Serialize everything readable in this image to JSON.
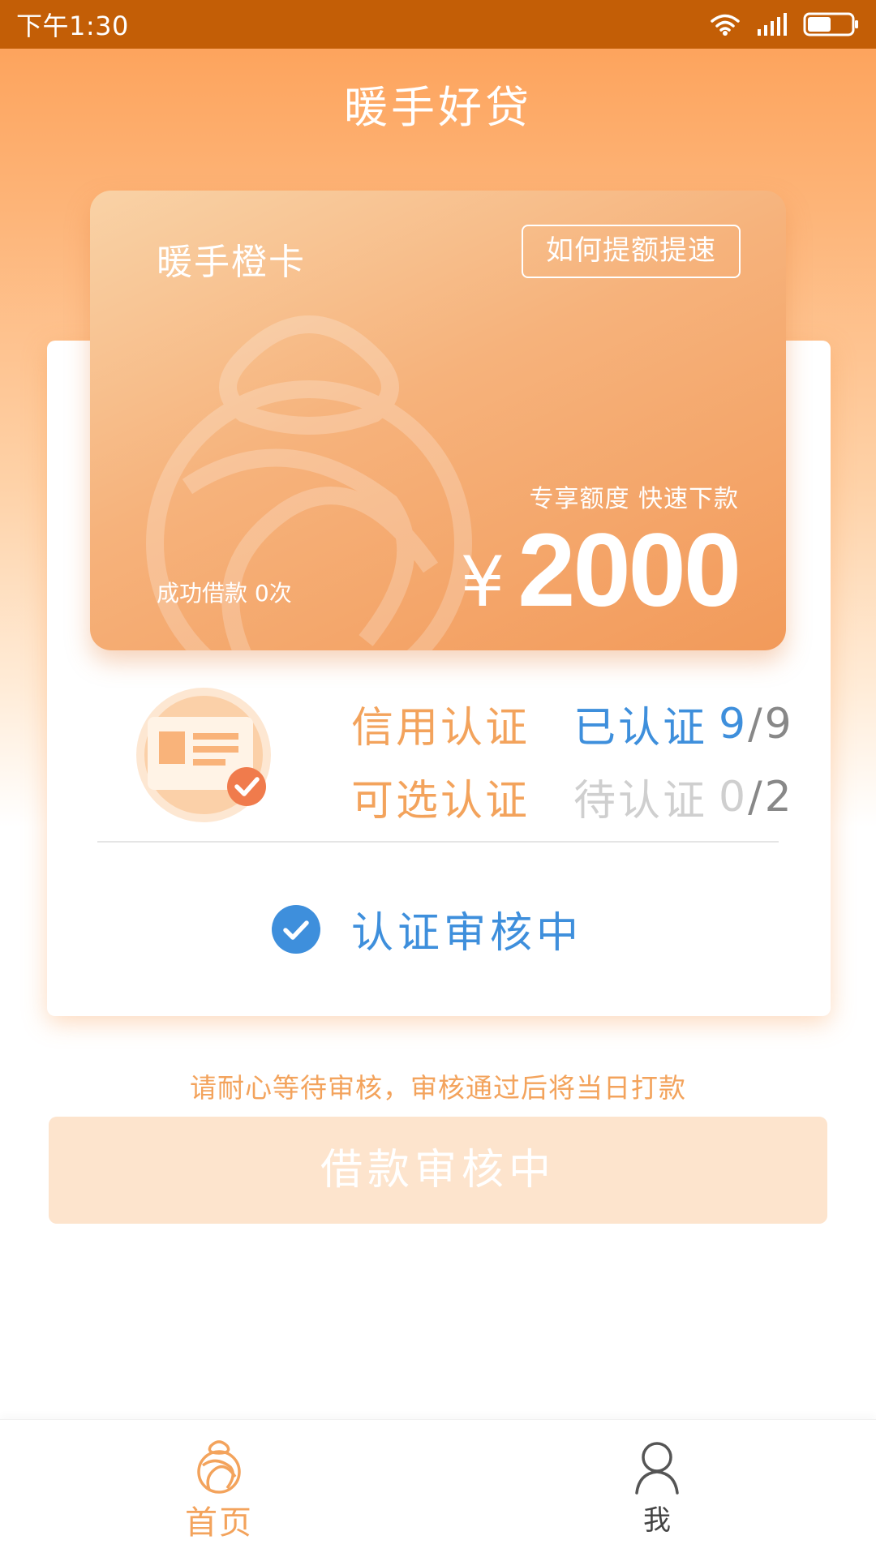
{
  "status_bar": {
    "time": "下午1:30",
    "icons": [
      "wifi-icon",
      "signal-icon",
      "battery-icon"
    ]
  },
  "header": {
    "title": "暖手好贷"
  },
  "card": {
    "name": "暖手橙卡",
    "button_label": "如何提额提速",
    "slogan": "专享额度 快速下款",
    "currency": "¥",
    "amount": "2000",
    "success_text": "成功借款 0次"
  },
  "certification": {
    "rows": [
      {
        "label": "信用认证",
        "status": "已认证",
        "done": "9",
        "sep": "/",
        "total": "9"
      },
      {
        "label": "可选认证",
        "status": "待认证",
        "done": "0",
        "sep": "/",
        "total": "2"
      }
    ],
    "review_status": "认证审核中"
  },
  "hint": "请耐心等待审核，审核通过后将当日打款",
  "loan_button": {
    "label": "借款审核中"
  },
  "bottom_nav": {
    "items": [
      {
        "label": "首页",
        "icon": "home-logo-icon",
        "active": true
      },
      {
        "label": "我",
        "icon": "user-icon",
        "active": false
      }
    ]
  },
  "colors": {
    "status_bar": "#c35e06",
    "accent_orange": "#f3a35c",
    "accent_blue": "#3e8fdc",
    "disabled_button": "#fde4cd"
  }
}
